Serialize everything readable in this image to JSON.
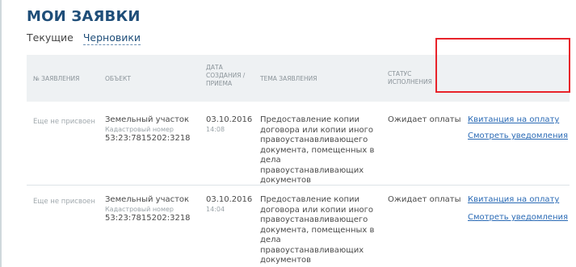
{
  "page": {
    "title": "МОИ ЗАЯВКИ",
    "tabs": [
      {
        "label": "Текущие",
        "active": false
      },
      {
        "label": "Черновики",
        "active": true
      }
    ]
  },
  "table": {
    "headers": {
      "number": "№ ЗАЯВЛЕНИЯ",
      "object": "ОБЪЕКТ",
      "date": "ДАТА СОЗДАНИЯ / ПРИЕМА",
      "topic": "ТЕМА ЗАЯВЛЕНИЯ",
      "status": "СТАТУС ИСПОЛНЕНИЯ"
    },
    "rows": [
      {
        "number": "Еще не присвоен",
        "object_name": "Земельный участок",
        "object_sublabel": "Кадастровый номер",
        "object_cadastral": "53:23:7815202:3218",
        "date": "03.10.2016",
        "time": "14:08",
        "topic": "Предоставление копии договора или копии иного правоустанавливающего документа, помещенных в дела правоустанавливающих документов",
        "status": "Ожидает оплаты",
        "link_receipt": "Квитанция на оплату",
        "link_notifications": "Смотреть уведомления"
      },
      {
        "number": "Еще не присвоен",
        "object_name": "Земельный участок",
        "object_sublabel": "Кадастровый номер",
        "object_cadastral": "53:23:7815202:3218",
        "date": "03.10.2016",
        "time": "14:04",
        "topic": "Предоставление копии договора или копии иного правоустанавливающего документа, помещенных в дела правоустанавливающих документов",
        "status": "Ожидает оплаты",
        "link_receipt": "Квитанция на оплату",
        "link_notifications": "Смотреть уведомления"
      }
    ]
  },
  "colors": {
    "title": "#1f4e79",
    "link": "#2a6ab5",
    "highlight_border": "#e8232a",
    "header_bg": "#eef1f3"
  }
}
